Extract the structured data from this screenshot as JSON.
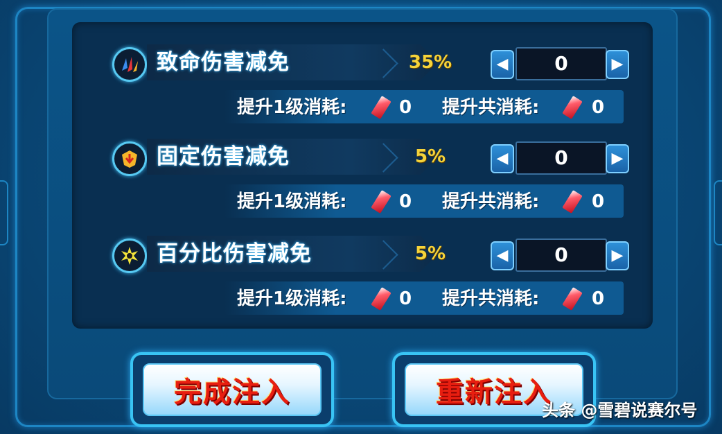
{
  "rows": [
    {
      "icon": "claw-burst-icon",
      "title": "致命伤害减免",
      "percent": "35%",
      "stepper_value": "0",
      "level_cost_label": "提升1级消耗:",
      "level_cost_value": "0",
      "total_cost_label": "提升共消耗:",
      "total_cost_value": "0"
    },
    {
      "icon": "shield-arrow-icon",
      "title": "固定伤害减免",
      "percent": "5%",
      "stepper_value": "0",
      "level_cost_label": "提升1级消耗:",
      "level_cost_value": "0",
      "total_cost_label": "提升共消耗:",
      "total_cost_value": "0"
    },
    {
      "icon": "star-burst-icon",
      "title": "百分比伤害减免",
      "percent": "5%",
      "stepper_value": "0",
      "level_cost_label": "提升1级消耗:",
      "level_cost_value": "0",
      "total_cost_label": "提升共消耗:",
      "total_cost_value": "0"
    }
  ],
  "stepper": {
    "decrease_icon": "arrow-left-icon",
    "increase_icon": "arrow-right-icon"
  },
  "cost_icon": "red-gem-icon",
  "buttons": {
    "complete": "完成注入",
    "reset": "重新注入"
  },
  "watermark": "头条 @雪碧说赛尔号",
  "colors": {
    "percent": "#f5d33a",
    "button_text": "#e81e10",
    "accent": "#39c4f4"
  }
}
